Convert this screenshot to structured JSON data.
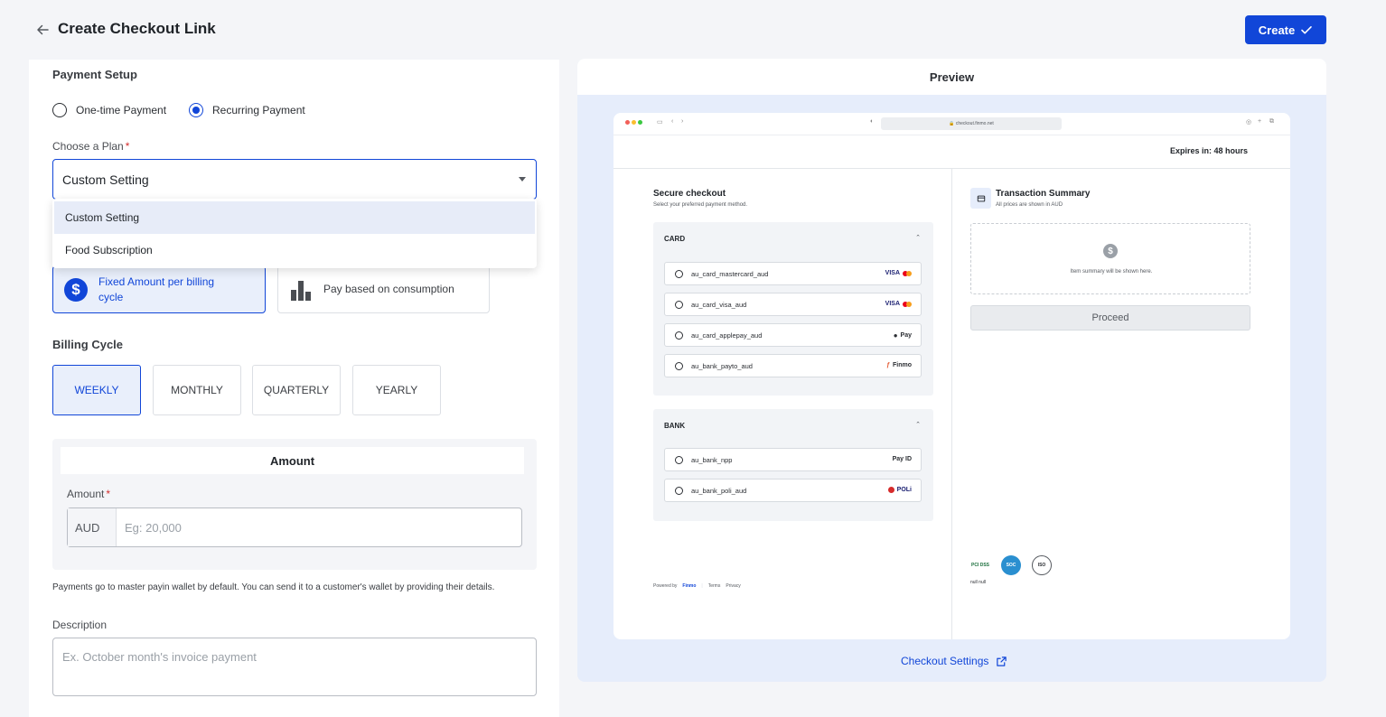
{
  "header": {
    "title": "Create Checkout Link",
    "create_label": "Create"
  },
  "payment_setup": {
    "title": "Payment Setup",
    "options": [
      {
        "label": "One-time Payment",
        "selected": false
      },
      {
        "label": "Recurring Payment",
        "selected": true
      }
    ]
  },
  "plan": {
    "label": "Choose a Plan",
    "required_mark": "*",
    "value": "Custom Setting",
    "dropdown_open": true,
    "options": [
      "Custom Setting",
      "Food Subscription"
    ],
    "highlighted": "Custom Setting"
  },
  "pricing_type": {
    "options": [
      {
        "label": "Fixed Amount per billing cycle",
        "selected": true,
        "icon": "dollar-icon"
      },
      {
        "label": "Pay based on consumption",
        "selected": false,
        "icon": "bar-chart-icon"
      }
    ]
  },
  "billing_cycle": {
    "title": "Billing Cycle",
    "options": [
      "WEEKLY",
      "MONTHLY",
      "QUARTERLY",
      "YEARLY"
    ],
    "selected": "WEEKLY"
  },
  "amount": {
    "section_title": "Amount",
    "label": "Amount",
    "required_mark": "*",
    "currency": "AUD",
    "placeholder": "Eg: 20,000",
    "helper": "Payments go to master payin wallet by default. You can send it to a customer's wallet by providing their details."
  },
  "description": {
    "label": "Description",
    "placeholder": "Ex. October month's invoice payment"
  },
  "preview": {
    "title": "Preview",
    "browser_url": "checkout.finmo.net",
    "expires": "Expires in: 48 hours",
    "secure_title": "Secure checkout",
    "secure_subtitle": "Select your preferred payment method.",
    "card_group": {
      "title": "CARD",
      "methods": [
        {
          "name": "au_card_mastercard_aud",
          "logo": "VISA"
        },
        {
          "name": "au_card_visa_aud",
          "logo": "VISA"
        },
        {
          "name": "au_card_applepay_aud",
          "logo": "Pay"
        },
        {
          "name": "au_bank_payto_aud",
          "logo": "Finmo"
        }
      ]
    },
    "bank_group": {
      "title": "BANK",
      "methods": [
        {
          "name": "au_bank_npp",
          "logo": "Pay ID"
        },
        {
          "name": "au_bank_poli_aud",
          "logo": "POLi"
        }
      ]
    },
    "powered_by": "Powered by",
    "powered_brand": "Finmo",
    "terms": "Terms",
    "privacy": "Privacy",
    "summary_title": "Transaction Summary",
    "summary_subtitle": "All prices are shown in AUD",
    "summary_empty": "Item summary will be shown here.",
    "proceed_label": "Proceed",
    "badge_caption": "null null",
    "badges": [
      "PCI DSS",
      "SOC",
      "ISO"
    ],
    "settings_link": "Checkout Settings"
  },
  "colors": {
    "accent": "#1146d8",
    "selected_bg": "#e9effb",
    "preview_bg": "#e6edfb"
  }
}
